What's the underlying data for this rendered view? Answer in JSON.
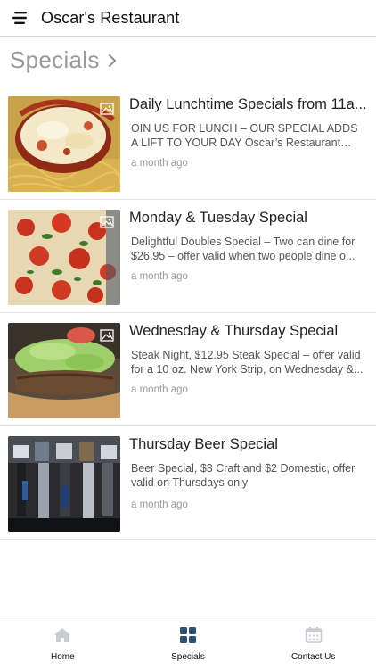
{
  "app": {
    "title": "Oscar's Restaurant",
    "accent_color": "#2d5370",
    "inactive_icon_color": "#c9ccd1"
  },
  "section": {
    "title": "Specials",
    "icon": "chevron-right-icon"
  },
  "specials": [
    {
      "title": "Daily Lunchtime Specials from 11a...",
      "description": "OIN US FOR LUNCH – OUR SPECIAL ADDS A LIFT TO YOUR DAY Oscar’s Restaurant offer...",
      "time": "a month ago",
      "image": "chicken-parmesan-photo"
    },
    {
      "title": "Monday & Tuesday Special",
      "description": "Delightful Doubles Special – Two can dine for $26.95 – offer valid when two people dine o...",
      "time": "a month ago",
      "image": "pizza-photo"
    },
    {
      "title": "Wednesday & Thursday Special",
      "description": "Steak Night, $12.95 Steak Special – offer valid for a 10 oz. New York Strip, on Wednesday &...",
      "time": "a month ago",
      "image": "steak-sandwich-photo"
    },
    {
      "title": "Thursday Beer Special",
      "description": "Beer Special, $3 Craft and $2 Domestic, offer valid on Thursdays only",
      "time": "a month ago",
      "image": "beer-taps-photo"
    }
  ],
  "tabs": [
    {
      "label": "Home",
      "icon": "home-icon",
      "active": false
    },
    {
      "label": "Specials",
      "icon": "grid-icon",
      "active": true
    },
    {
      "label": "Contact Us",
      "icon": "calendar-icon",
      "active": false
    }
  ]
}
